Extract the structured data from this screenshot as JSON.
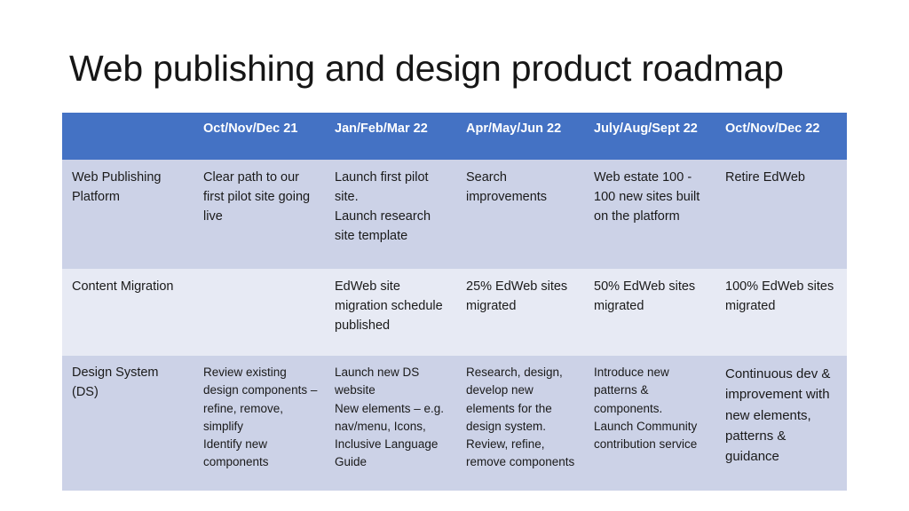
{
  "slide": {
    "title": "Web publishing and design product roadmap",
    "colors": {
      "header_bg": "#4472C4",
      "row_dark": "#CCD2E7",
      "row_light": "#E7EAF4",
      "header_text": "#FFFFFF",
      "body_text": "#1A1A1A",
      "title_text": "#161616"
    }
  },
  "table": {
    "headers": [
      "",
      "Oct/Nov/Dec 21",
      "Jan/Feb/Mar 22",
      "Apr/May/Jun 22",
      "July/Aug/Sept 22",
      "Oct/Nov/Dec 22"
    ],
    "rows": [
      {
        "label": "Web Publishing Platform",
        "cells": [
          [
            "Clear path to our first pilot site going live"
          ],
          [
            "Launch first pilot site.",
            "Launch research site template"
          ],
          [
            "Search improvements"
          ],
          [
            "Web estate 100 - 100 new sites built on the platform"
          ],
          [
            "Retire EdWeb"
          ]
        ]
      },
      {
        "label": "Content Migration",
        "cells": [
          [
            ""
          ],
          [
            "EdWeb site migration schedule published"
          ],
          [
            "25% EdWeb sites migrated"
          ],
          [
            "50% EdWeb sites migrated"
          ],
          [
            "100% EdWeb sites migrated"
          ]
        ]
      },
      {
        "label": "Design System (DS)",
        "cells": [
          [
            "Review existing design components – refine, remove, simplify",
            "Identify new components"
          ],
          [
            "Launch new DS website",
            "New elements – e.g. nav/menu, Icons, Inclusive Language Guide"
          ],
          [
            "Research,  design, develop new elements for the design system.",
            "Review, refine, remove components"
          ],
          [
            "Introduce new patterns  & components.",
            "Launch Community contribution service"
          ],
          [
            "Continuous dev & improvement with new elements, patterns & guidance"
          ]
        ]
      }
    ]
  }
}
